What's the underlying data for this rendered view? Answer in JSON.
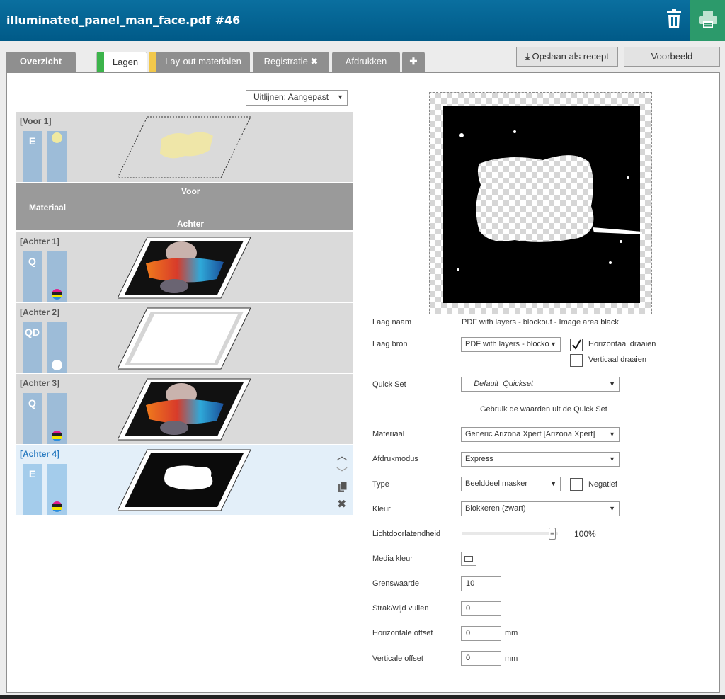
{
  "window": {
    "title": "illuminated_panel_man_face.pdf #46"
  },
  "header": {
    "trash_icon": "trash-icon",
    "print_icon": "printer-icon"
  },
  "tabs": [
    {
      "label": "Overzicht"
    },
    {
      "label": "Lagen",
      "marker_color": "#3cb44b"
    },
    {
      "label": "Lay-out materialen",
      "marker_color": "#f2c84b"
    },
    {
      "label": "Registratie",
      "suffix": "✖"
    },
    {
      "label": "Afdrukken"
    },
    {
      "label": "✚"
    }
  ],
  "toolbar": {
    "save_recipe": "Opslaan als recept",
    "preview": "Voorbeeld"
  },
  "align": {
    "value": "Uitlijnen: Aangepast"
  },
  "layers": {
    "front1": {
      "title": "[Voor 1]",
      "mode": "E"
    },
    "material_row": {
      "front": "Voor",
      "label": "Materiaal",
      "back": "Achter"
    },
    "back1": {
      "title": "[Achter 1]",
      "mode": "Q"
    },
    "back2": {
      "title": "[Achter 2]",
      "mode": "QD"
    },
    "back3": {
      "title": "[Achter 3]",
      "mode": "Q"
    },
    "back4": {
      "title": "[Achter 4]",
      "mode": "E"
    }
  },
  "form": {
    "layer_name_label": "Laag naam",
    "layer_name_value": "PDF with layers - blockout - Image area black",
    "layer_source_label": "Laag bron",
    "layer_source_value": "PDF with layers - blocko",
    "flip_h_label": "Horizontaal draaien",
    "flip_v_label": "Verticaal draaien",
    "quickset_label": "Quick Set",
    "quickset_value": "__Default_Quickset__",
    "use_quickset_label": "Gebruik de waarden uit de Quick Set",
    "material_label": "Materiaal",
    "material_value": "Generic Arizona Xpert [Arizona Xpert]",
    "printmode_label": "Afdrukmodus",
    "printmode_value": "Express",
    "type_label": "Type",
    "type_value": "Beelddeel masker",
    "negative_label": "Negatief",
    "color_label": "Kleur",
    "color_value": "Blokkeren (zwart)",
    "opacity_label": "Lichtdoorlatendheid",
    "opacity_value": "100%",
    "opacity_fraction": 1.0,
    "media_color_label": "Media kleur",
    "threshold_label": "Grenswaarde",
    "threshold_value": "10",
    "fill_label": "Strak/wijd vullen",
    "fill_value": "0",
    "h_offset_label": "Horizontale offset",
    "h_offset_value": "0",
    "h_offset_unit": "mm",
    "v_offset_label": "Verticale offset",
    "v_offset_value": "0",
    "v_offset_unit": "mm"
  }
}
